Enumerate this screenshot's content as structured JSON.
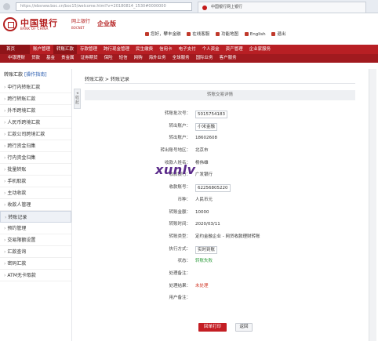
{
  "browser": {
    "url": "https://ebsnew.boc.cn/boc15/welcome.html?v=20180814_1530#0000000",
    "tab_title": "中国银行网上银行"
  },
  "header": {
    "logo_cn": "中国银行",
    "logo_en": "BANK OF CHINA",
    "netbank_cn": "网上银行",
    "netbank_en": "BOCNET",
    "edition": "企业版",
    "greeting": "您好，攀丰金融",
    "links": [
      "在线客服",
      "功能地图",
      "English",
      "退出"
    ]
  },
  "nav": {
    "home": "首页",
    "primary": [
      "账户管理",
      "转账汇款",
      "存款管理",
      "跨行现金管理",
      "民生缴费",
      "信用卡",
      "电子支付",
      "个人资金",
      "资产管理",
      "企业家服务"
    ],
    "active_primary": "转账汇款",
    "secondary": [
      "中银理财",
      "贷款",
      "基金",
      "贵金属",
      "证券期货",
      "保险",
      "短信",
      "网购",
      "海外业务",
      "全球服务",
      "国际业务",
      "客户服务"
    ]
  },
  "sidebar": {
    "title": "转账汇款",
    "guide": "[操作指南]",
    "items": [
      "中行内转账汇款",
      "跨行转账汇款",
      "外币跨境汇款",
      "人民币跨境汇款",
      "汇款公司跨境汇款",
      "跨行资金归集",
      "行内资金归集",
      "批量转账",
      "手机取款",
      "主动收款",
      "收款人管理",
      "转账记录",
      "预约管理",
      "交易限额设置",
      "汇款查询",
      "密码汇款",
      "ATM无卡取款"
    ],
    "active_item": "转账记录"
  },
  "breadcrumb": "转账汇款 > 转账记录",
  "panel": {
    "title": "转账交易详情",
    "rows": [
      {
        "label": "转账批次号：",
        "value": "5015754183",
        "style": "boxed"
      },
      {
        "label": "转出账户：",
        "value": "小米金融",
        "style": "boxed"
      },
      {
        "label": "转出账户：",
        "value": "18602608",
        "style": ""
      },
      {
        "label": "转出账号地区：",
        "value": "北京市",
        "style": ""
      },
      {
        "label": "收款人姓名：",
        "value": "杨伟雄",
        "style": ""
      },
      {
        "label": "收款银行：",
        "value": "广发银行",
        "style": ""
      },
      {
        "label": "收款账号：",
        "value": "62256805220",
        "style": "boxed"
      },
      {
        "label": "币种：",
        "value": "人民币元",
        "style": ""
      },
      {
        "label": "转账金额：",
        "value": "10000",
        "style": ""
      },
      {
        "label": "转账时间：",
        "value": "2020/03/11",
        "style": ""
      },
      {
        "label": "转账类型：",
        "value": "定约金融企业 - 网贷收款理财转账",
        "style": ""
      },
      {
        "label": "执行方式：",
        "value": "实时到账",
        "style": "boxed"
      },
      {
        "label": "状态：",
        "value": "转账失败",
        "style": "green"
      },
      {
        "label": "处理备注：",
        "value": "",
        "style": ""
      },
      {
        "label": "处理结果：",
        "value": "未处理",
        "style": "red"
      },
      {
        "label": "用户备注：",
        "value": "",
        "style": ""
      }
    ]
  },
  "buttons": {
    "print": "回单打印",
    "back": "返回"
  },
  "watermark": "xunlv",
  "colors": {
    "brand_red": "#b81f24",
    "status_green": "#2e9c3c",
    "status_red": "#d23a2a"
  }
}
